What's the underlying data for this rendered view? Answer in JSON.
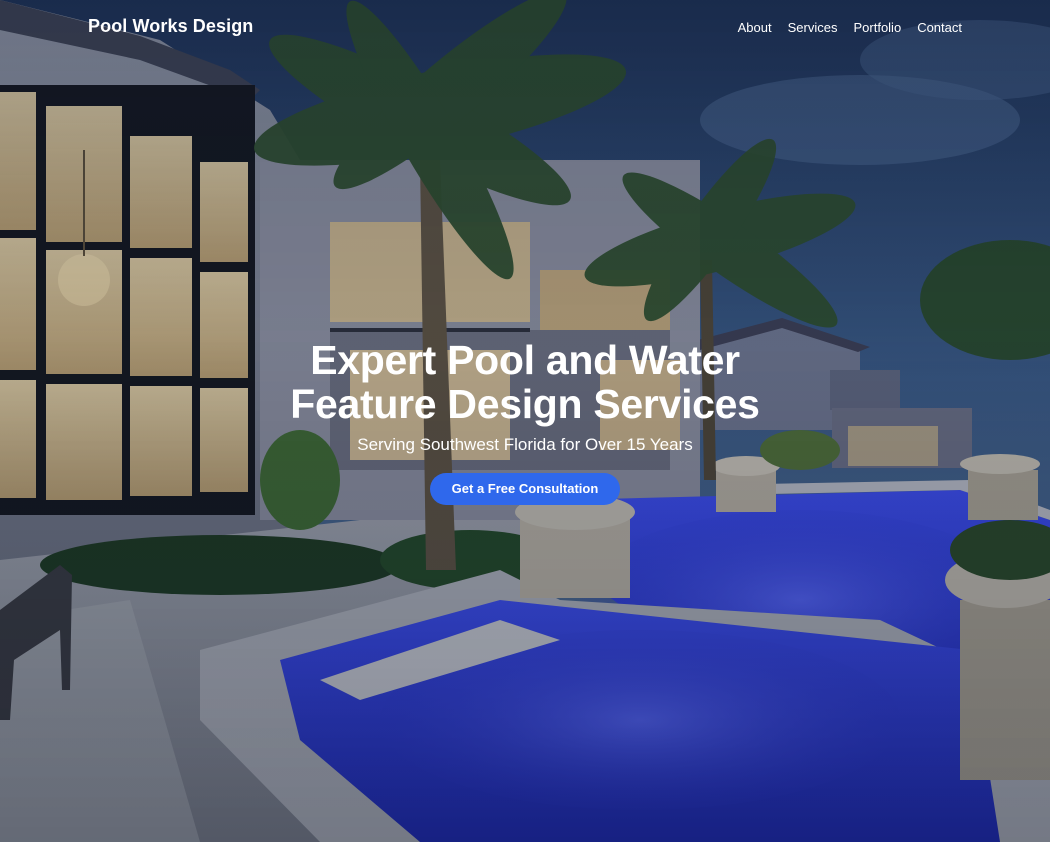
{
  "brand": {
    "name": "Pool Works Design"
  },
  "nav": {
    "items": [
      {
        "label": "About"
      },
      {
        "label": "Services"
      },
      {
        "label": "Portfolio"
      },
      {
        "label": "Contact"
      }
    ]
  },
  "hero": {
    "headline_line1": "Expert Pool and Water",
    "headline_line2": "Feature Design Services",
    "subheadline": "Serving Southwest Florida for Over 15 Years",
    "cta_label": "Get a Free Consultation",
    "background_image": "luxury-home-pool-at-dusk"
  },
  "colors": {
    "accent": "#2f68ec",
    "text": "#ffffff",
    "pool": "#2f3fd8",
    "sky": "#2d4a78"
  }
}
